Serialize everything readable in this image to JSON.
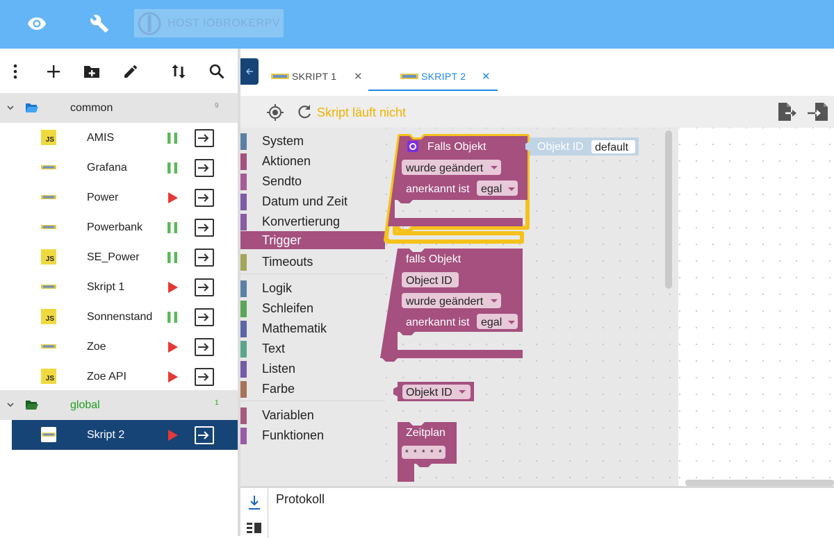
{
  "topbar": {
    "host_label": "HOST IOBROKERPV",
    "color": "#64b5f6"
  },
  "tree": {
    "folders": [
      {
        "name": "common",
        "count": "9",
        "color": "#222222"
      },
      {
        "name": "global",
        "count": "1",
        "color": "#1e9e1e"
      }
    ],
    "scripts": [
      {
        "name": "AMIS",
        "type": "js",
        "state": "pause"
      },
      {
        "name": "Grafana",
        "type": "blockly",
        "state": "pause"
      },
      {
        "name": "Power",
        "type": "blockly",
        "state": "play"
      },
      {
        "name": "Powerbank",
        "type": "blockly",
        "state": "pause"
      },
      {
        "name": "SE_Power",
        "type": "js",
        "state": "pause"
      },
      {
        "name": "Skript 1",
        "type": "blockly",
        "state": "play"
      },
      {
        "name": "Sonnenstand",
        "type": "js",
        "state": "pause"
      },
      {
        "name": "Zoe",
        "type": "blockly",
        "state": "play"
      },
      {
        "name": "Zoe API",
        "type": "js",
        "state": "play"
      },
      {
        "name": "Skript 2",
        "type": "blockly",
        "state": "play",
        "selected": true
      }
    ]
  },
  "tabs": [
    {
      "label": "SKRIPT 1",
      "close": "✕",
      "active": false
    },
    {
      "label": "SKRIPT 2",
      "close": "✕",
      "active": true
    }
  ],
  "editor": {
    "status": "Skript läuft nicht"
  },
  "toolbox": {
    "categories": [
      {
        "label": "System",
        "color": "#5b80a5"
      },
      {
        "label": "Aktionen",
        "color": "#a5507f"
      },
      {
        "label": "Sendto",
        "color": "#a55b99"
      },
      {
        "label": "Datum und Zeit",
        "color": "#7e5ba5"
      },
      {
        "label": "Konvertierung",
        "color": "#8a5ba5"
      },
      {
        "label": "Trigger",
        "color": "#a5507f",
        "active": true
      },
      {
        "label": "Timeouts",
        "color": "#a5a55b"
      },
      {
        "label": "Logik",
        "color": "#5b80a5"
      },
      {
        "label": "Schleifen",
        "color": "#5ba55b"
      },
      {
        "label": "Mathematik",
        "color": "#5b67a5"
      },
      {
        "label": "Text",
        "color": "#5ba58c"
      },
      {
        "label": "Listen",
        "color": "#745ba5"
      },
      {
        "label": "Farbe",
        "color": "#a5745b"
      },
      {
        "label": "Variablen",
        "color": "#a55b80"
      },
      {
        "label": "Funktionen",
        "color": "#995ba5"
      }
    ]
  },
  "blocks": {
    "falls_objekt": {
      "title": "Falls Objekt",
      "changed": "wurde geändert",
      "ack_label": "anerkannt ist",
      "ack_value": "egal",
      "object_id_label": "Objekt ID",
      "object_id_value": "default"
    },
    "falls_objekt2": {
      "title": "falls Objekt",
      "object_id": "Object ID",
      "changed": "wurde geändert",
      "ack_label": "anerkannt ist",
      "ack_value": "egal"
    },
    "objekt_id": {
      "label": "Objekt ID"
    },
    "zeitplan": {
      "title": "Zeitplan",
      "cron": "* * * * *"
    }
  },
  "log": {
    "title": "Protokoll"
  }
}
